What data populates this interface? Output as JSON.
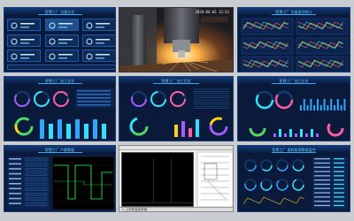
{
  "panels": {
    "p1": {
      "title": "智慧工厂 设备总览"
    },
    "p2": {
      "timestamp": "2020-04-02 12:52"
    },
    "p3": {
      "title": "智慧工厂 设备监控统计"
    },
    "p4": {
      "title": "智慧工厂 加工总览"
    },
    "p5": {
      "title": "智慧工厂 加工总览"
    },
    "p6": {
      "title": "智慧工厂 加工总览"
    },
    "p7": {
      "title": "智慧工厂 产能数据"
    },
    "p8": {
      "status_text": "◇ 上位机监控系统"
    },
    "p9": {
      "title": "智慧工厂 能耗能源数据监控"
    }
  },
  "colors": {
    "bg": "#0a1a3a",
    "accent": "#2fa6ff",
    "cyan": "#35e0ff",
    "green": "#4cd964",
    "yellow": "#ffd21f",
    "pink": "#ff5fa2",
    "purple": "#a45cff"
  }
}
